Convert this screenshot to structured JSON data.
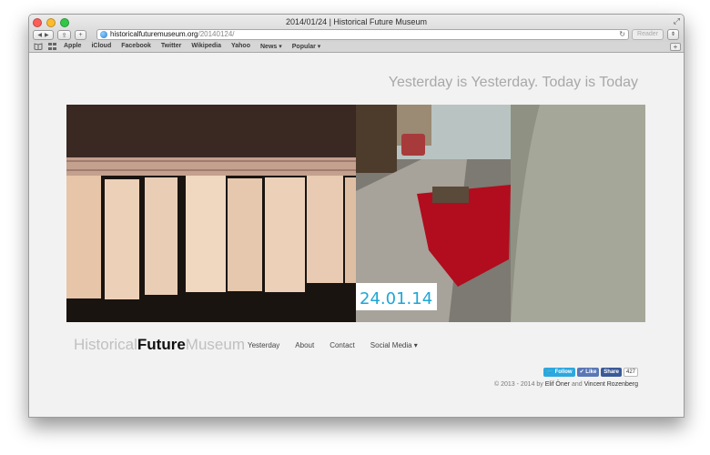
{
  "window": {
    "title": "2014/01/24 | Historical Future Museum",
    "url_host": "historicalfuturemuseum.org",
    "url_path": "/20140124/",
    "reader_label": "Reader"
  },
  "toolbar": {
    "back_glyph": "◀",
    "forward_glyph": "▶",
    "share_glyph": "⇪",
    "add_glyph": "+",
    "reload_glyph": "↻",
    "downloads_glyph": "⌽"
  },
  "bookmarks": [
    "Apple",
    "iCloud",
    "Facebook",
    "Twitter",
    "Wikipedia",
    "Yahoo",
    "News ▾",
    "Popular ▾"
  ],
  "page": {
    "tagline": "Yesterday is Yesterday. Today is Today",
    "hero_date_stamp": "24.01.14",
    "logo": {
      "part1": "Historical",
      "part2": "Future",
      "part3": "Museum"
    },
    "nav": [
      "Yesterday",
      "About",
      "Contact",
      "Social Media ▾"
    ],
    "social": {
      "follow": "Follow",
      "like": "Like",
      "share": "Share",
      "count": "427"
    },
    "footer": {
      "prefix": "© 2013 - 2014 by ",
      "author1": "Elif Öner",
      "and": " and ",
      "author2": "Vincent Rozenberg"
    }
  },
  "colors": {
    "close": "#fc5f57",
    "minimize": "#fdbc2e",
    "zoom": "#33c748",
    "twitter": "#2ba8df",
    "facebook": "#5a77b6"
  },
  "icons": [
    "back-icon",
    "forward-icon",
    "share-icon",
    "add-tab-icon",
    "globe-icon",
    "reload-icon",
    "downloads-icon",
    "reading-list-icon",
    "top-sites-icon",
    "fullscreen-icon",
    "caret-down-icon"
  ]
}
